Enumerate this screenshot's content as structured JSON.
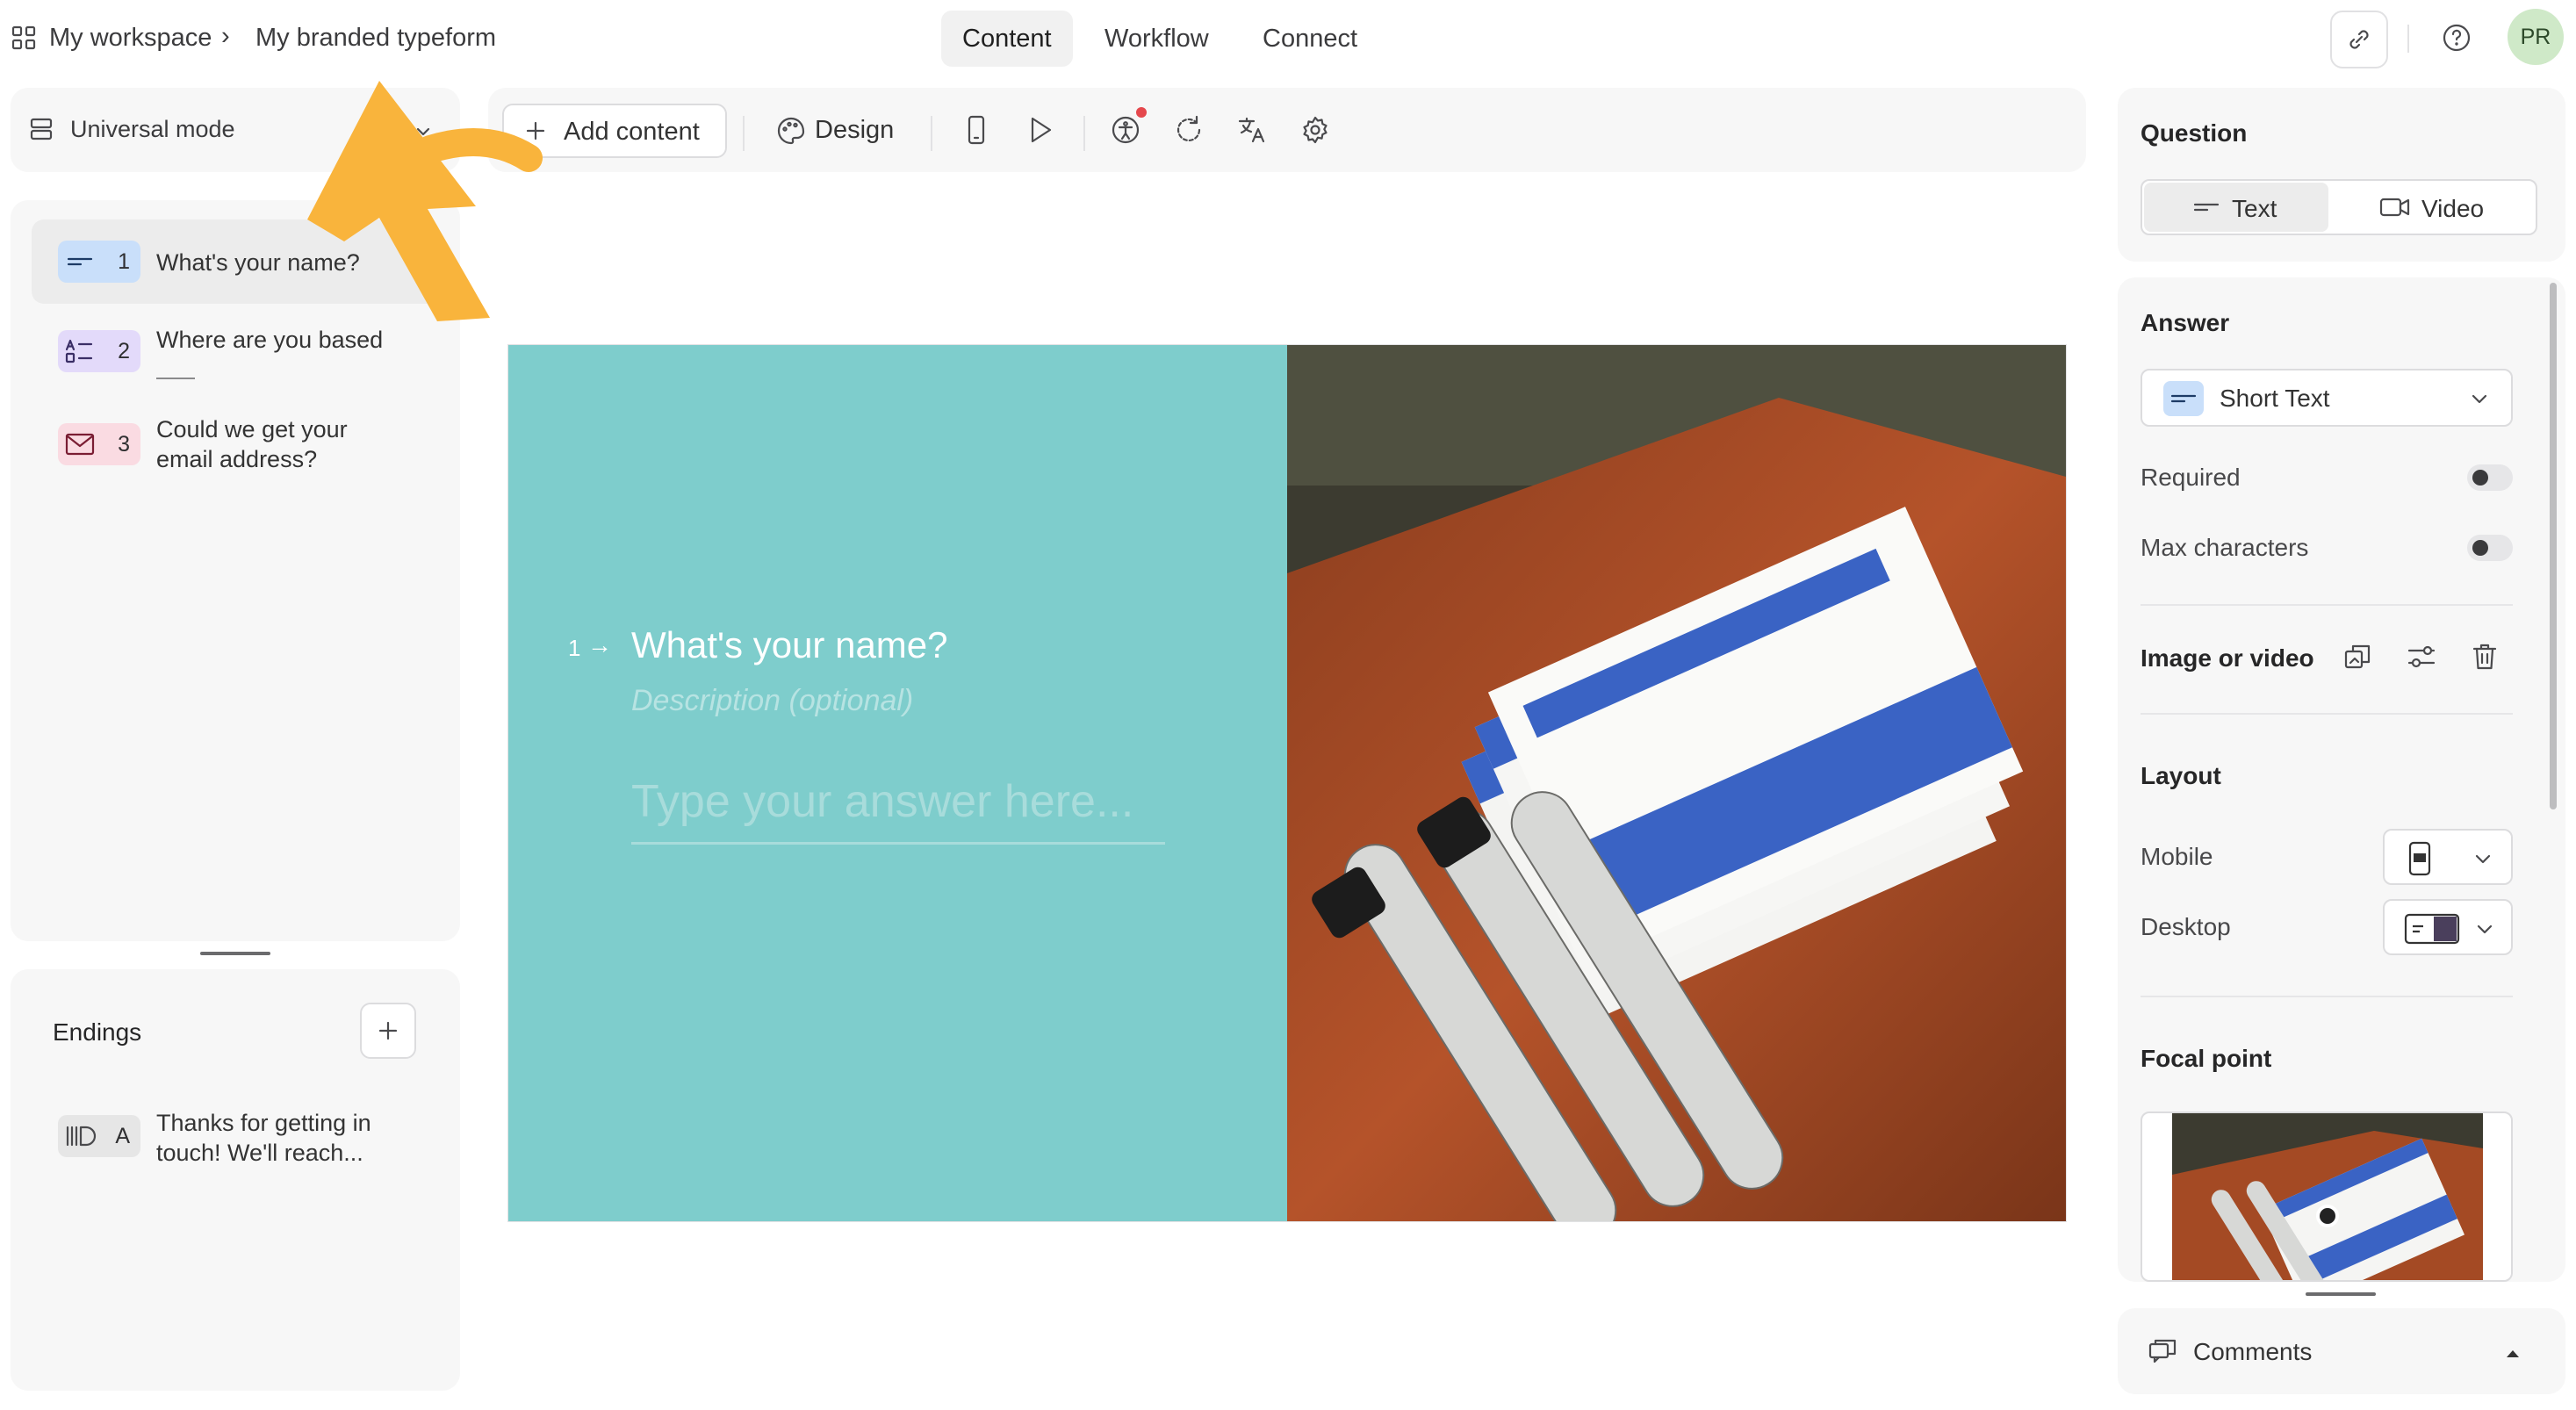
{
  "header": {
    "workspace": "My workspace",
    "separator": "›",
    "form_name": "My branded typeform",
    "tabs": [
      {
        "label": "Content",
        "active": true
      },
      {
        "label": "Workflow",
        "active": false
      },
      {
        "label": "Connect",
        "active": false
      }
    ],
    "avatar_initials": "PR"
  },
  "left": {
    "mode_label": "Universal mode",
    "questions": [
      {
        "number": "1",
        "text": "What's your name?",
        "icon": "short-text-icon",
        "color": "#c9dffa"
      },
      {
        "number": "2",
        "text": "Where are you based",
        "icon": "multiple-choice-icon",
        "color": "#e3dafa"
      },
      {
        "number": "3",
        "text": "Could we get your email address?",
        "icon": "mail-icon",
        "color": "#fadbe2"
      }
    ],
    "endings_title": "Endings",
    "endings": [
      {
        "letter": "A",
        "text": "Thanks for getting in touch! We'll reach...",
        "icon": "ending-icon",
        "color": "#e6e6e6"
      }
    ]
  },
  "toolbar": {
    "add_content": "Add content",
    "design": "Design"
  },
  "canvas": {
    "question_number": "1",
    "arrow": "→",
    "question": "What's your name?",
    "description": "Description (optional)",
    "answer_placeholder": "Type your answer here...",
    "background_color": "#7ecdcc"
  },
  "right": {
    "question_title": "Question",
    "question_types": [
      {
        "label": "Text",
        "active": true
      },
      {
        "label": "Video",
        "active": false
      }
    ],
    "answer_title": "Answer",
    "answer_type": "Short Text",
    "required_label": "Required",
    "required_on": false,
    "max_chars_label": "Max characters",
    "max_chars_on": false,
    "image_video_label": "Image or video",
    "layout_title": "Layout",
    "mobile_label": "Mobile",
    "desktop_label": "Desktop",
    "focal_point_title": "Focal point",
    "comments_label": "Comments"
  },
  "colors": {
    "accent_arrow": "#f9b43c",
    "avatar_bg": "#cfe9c8"
  }
}
